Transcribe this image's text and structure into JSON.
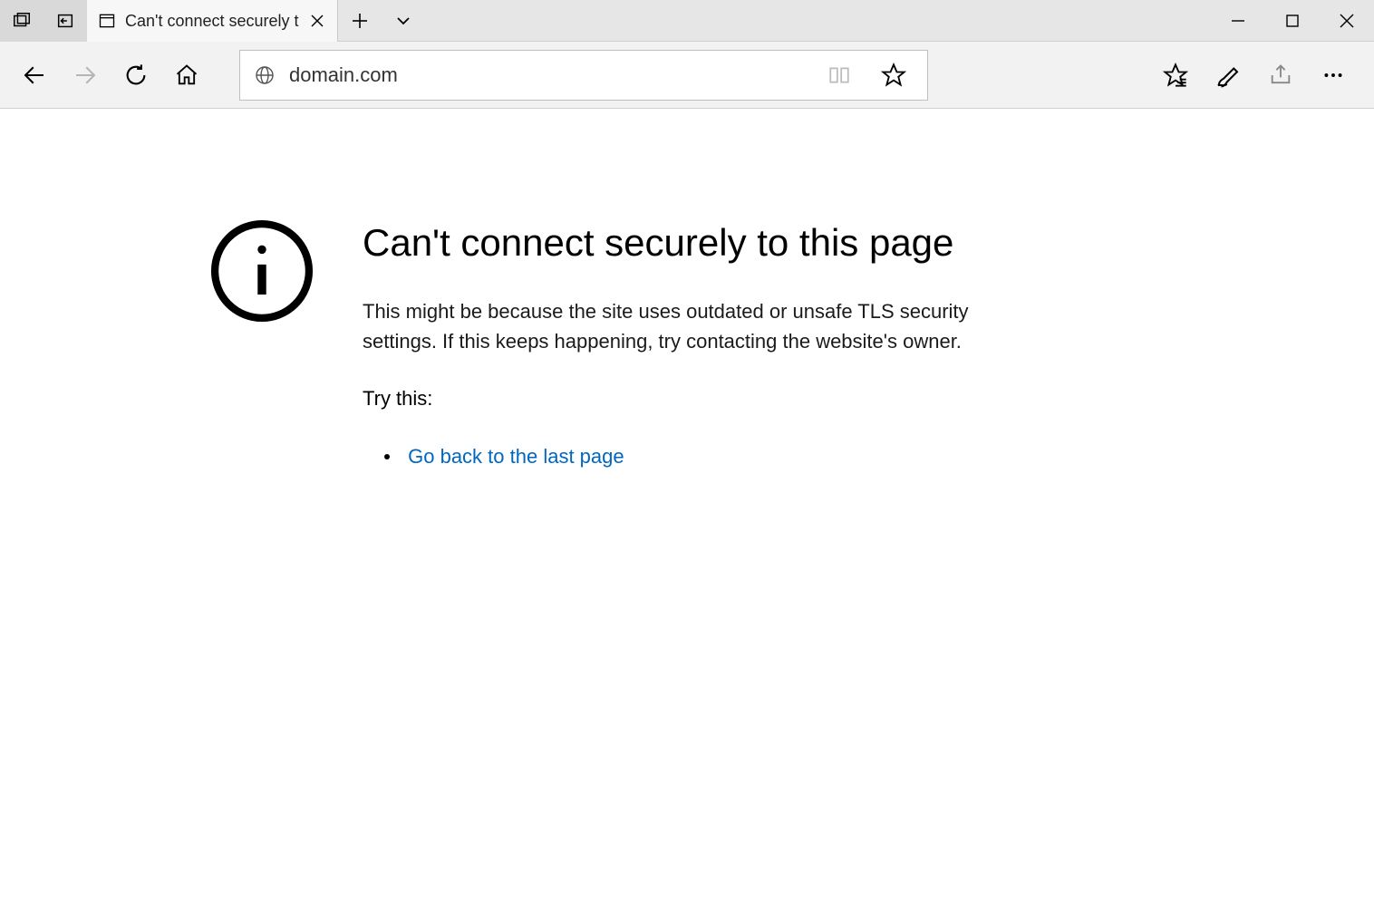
{
  "tab": {
    "title": "Can't connect securely t"
  },
  "address": {
    "url": "domain.com"
  },
  "page": {
    "headline": "Can't connect securely to this page",
    "description": "This might be because the site uses outdated or unsafe TLS security settings. If this keeps happening, try contacting the website's owner.",
    "try_label": "Try this:",
    "suggestion_link": "Go back to the last page"
  }
}
